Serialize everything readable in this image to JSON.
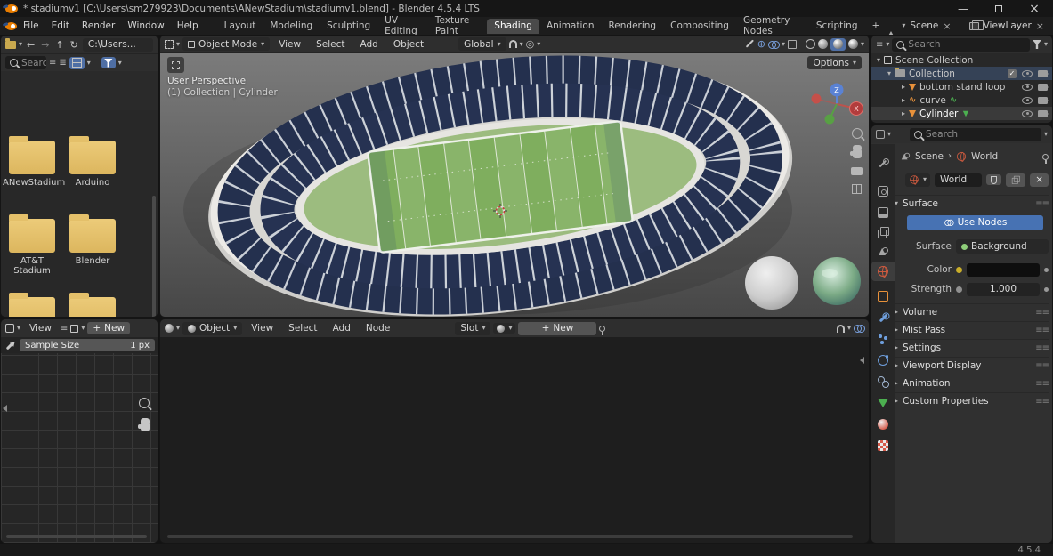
{
  "colors": {
    "accent": "#4772b3",
    "socket_yellow": "#c9ae2a",
    "socket_gray": "#8f8f8f",
    "object_orange": "#e8913a",
    "mesh_green": "#4caf50",
    "folder_yellow": "#e0bd6e",
    "field_green": "#7fae5e",
    "stand_navy": "#25304f",
    "world_color_swatch": "#0e0e0e"
  },
  "icons": {
    "chevron_down": "▾",
    "chevron_right": "▸",
    "breadcrumb_sep": "›",
    "back_arrow": "←",
    "forward_arrow": "→",
    "up_arrow": "↑",
    "refresh": "↻",
    "minimize": "—",
    "close": "×",
    "check": "✓",
    "plus": "+",
    "menu_lines": "≡",
    "grip": "≡≡",
    "prop_edit": "◎",
    "gizmo_toggle": "⊕",
    "list_lines": "≣"
  },
  "titlebar": {
    "title": "* stadiumv1 [C:\\Users\\sm279923\\Documents\\ANewStadium\\stadiumv1.blend] - Blender 4.5.4 LTS"
  },
  "topbar": {
    "menus": [
      {
        "label": "File"
      },
      {
        "label": "Edit"
      },
      {
        "label": "Render"
      },
      {
        "label": "Window"
      },
      {
        "label": "Help"
      }
    ],
    "workspaces": [
      {
        "label": "Layout"
      },
      {
        "label": "Modeling"
      },
      {
        "label": "Sculpting"
      },
      {
        "label": "UV Editing"
      },
      {
        "label": "Texture Paint"
      },
      {
        "label": "Shading"
      },
      {
        "label": "Animation"
      },
      {
        "label": "Rendering"
      },
      {
        "label": "Compositing"
      },
      {
        "label": "Geometry Nodes"
      },
      {
        "label": "Scripting"
      }
    ],
    "add_workspace": "+",
    "scene_selector": {
      "label": "Scene"
    },
    "view_layer_selector": {
      "label": "ViewLayer"
    }
  },
  "file_browser": {
    "path": "C:\\Users...",
    "search_placeholder": "Search",
    "folders": [
      {
        "name": "ANewStadium"
      },
      {
        "name": "Arduino"
      },
      {
        "name": "AT&T Stadium"
      },
      {
        "name": "Blender"
      },
      {
        "name": ""
      },
      {
        "name": ""
      }
    ]
  },
  "viewport": {
    "mode": "Object Mode",
    "menus": [
      {
        "label": "View"
      },
      {
        "label": "Select"
      },
      {
        "label": "Add"
      },
      {
        "label": "Object"
      }
    ],
    "orientation": "Global",
    "options_label": "Options",
    "overlay": {
      "line1": "User Perspective",
      "line2": "(1) Collection | Cylinder"
    },
    "gizmo": {
      "z_label": "Z",
      "x_label": "X"
    }
  },
  "outliner": {
    "search_placeholder": "Search",
    "rows": [
      {
        "label": "Scene Collection"
      },
      {
        "label": "Collection"
      },
      {
        "label": "bottom stand loop"
      },
      {
        "label": "curve"
      },
      {
        "label": "Cylinder"
      }
    ]
  },
  "properties": {
    "search_placeholder": "Search",
    "breadcrumb": {
      "scene": "Scene",
      "world": "World"
    },
    "world_name": "World",
    "surface_panel": {
      "title": "Surface",
      "use_nodes_label": "Use Nodes",
      "surface_label": "Surface",
      "surface_value": "Background",
      "color_label": "Color",
      "strength_label": "Strength",
      "strength_value": "1.000"
    },
    "collapsed_panels": [
      {
        "title": "Volume"
      },
      {
        "title": "Mist Pass"
      },
      {
        "title": "Settings"
      },
      {
        "title": "Viewport Display"
      },
      {
        "title": "Animation"
      },
      {
        "title": "Custom Properties"
      }
    ]
  },
  "image_editor": {
    "view_menu": "View",
    "new_label": "New",
    "sample_size_label": "Sample Size",
    "sample_size_value": "1 px"
  },
  "shader_editor": {
    "shader_type": "Object",
    "menus": [
      {
        "label": "View"
      },
      {
        "label": "Select"
      },
      {
        "label": "Add"
      },
      {
        "label": "Node"
      }
    ],
    "slot_label": "Slot",
    "new_label": "New"
  },
  "statusbar": {
    "version": "4.5.4"
  }
}
